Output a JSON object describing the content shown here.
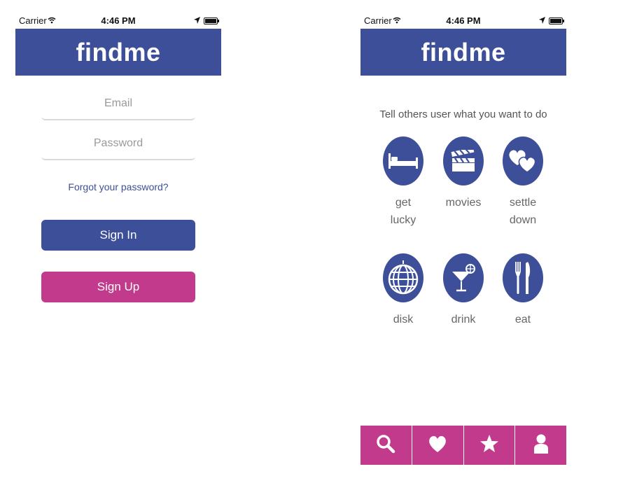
{
  "status": {
    "carrier": "Carrier",
    "time": "4:46 PM"
  },
  "app": {
    "title": "findme"
  },
  "login": {
    "email_placeholder": "Email",
    "password_placeholder": "Password",
    "forgot_label": "Forgot your password?",
    "signin_label": "Sign In",
    "signup_label": "Sign Up"
  },
  "activities": {
    "prompt": "Tell others user what you want to do",
    "items": [
      {
        "line1": "get",
        "line2": "lucky",
        "icon": "bed-icon"
      },
      {
        "line1": "movies",
        "line2": "",
        "icon": "clapperboard-icon"
      },
      {
        "line1": "settle",
        "line2": "down",
        "icon": "hearts-icon"
      },
      {
        "line1": "disk",
        "line2": "",
        "icon": "disco-ball-icon"
      },
      {
        "line1": "drink",
        "line2": "",
        "icon": "cocktail-icon"
      },
      {
        "line1": "eat",
        "line2": "",
        "icon": "fork-knife-icon"
      }
    ]
  },
  "tabbar": {
    "items": [
      {
        "icon": "search-icon"
      },
      {
        "icon": "heart-icon"
      },
      {
        "icon": "star-icon"
      },
      {
        "icon": "user-icon"
      }
    ]
  },
  "colors": {
    "primary": "#3c4f98",
    "accent": "#c23a8b"
  }
}
